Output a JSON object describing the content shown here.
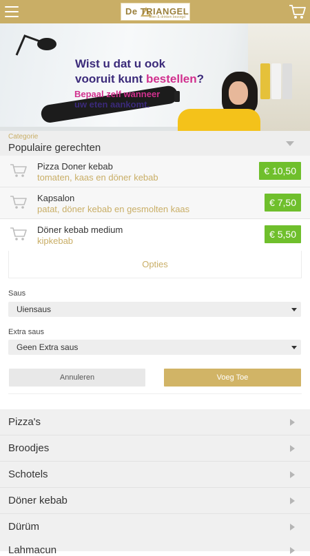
{
  "header": {
    "brand_text": "De TRIANGEL",
    "brand_tagline": "Eten & drinken bezorgd",
    "menu_icon": "hamburger-icon",
    "cart_icon": "cart-icon",
    "bg_color": "#c9ae66"
  },
  "banner": {
    "line1": "Wist u dat u ook",
    "line2_a": "vooruit kunt ",
    "line2_b": "bestellen",
    "line2_c": "?",
    "sub1": "Bepaal zelf wanneer",
    "sub2": "uw eten aankomt."
  },
  "category": {
    "label": "Categorie",
    "value": "Populaire gerechten"
  },
  "products": [
    {
      "name": "Pizza Doner kebab",
      "desc": "tomaten, kaas en döner kebab",
      "price": "€ 10,50"
    },
    {
      "name": "Kapsalon",
      "desc": "patat, döner kebab en gesmolten kaas",
      "price": "€ 7,50"
    },
    {
      "name": "Döner kebab medium",
      "desc": "kipkebab",
      "price": "€ 5,50"
    }
  ],
  "options": {
    "title": "Opties",
    "saus_label": "Saus",
    "saus_value": "Uiensaus",
    "extra_label": "Extra saus",
    "extra_value": "Geen Extra saus",
    "cancel_label": "Annuleren",
    "add_label": "Voeg Toe"
  },
  "categories": [
    {
      "label": "Pizza's"
    },
    {
      "label": "Broodjes"
    },
    {
      "label": "Schotels"
    },
    {
      "label": "Döner kebab"
    },
    {
      "label": "Dürüm"
    },
    {
      "label": "Lahmacun"
    }
  ],
  "colors": {
    "accent": "#c9ae66",
    "price_green": "#6fbf2c",
    "banner_purple": "#3b2a7a",
    "banner_pink": "#d1308e"
  }
}
